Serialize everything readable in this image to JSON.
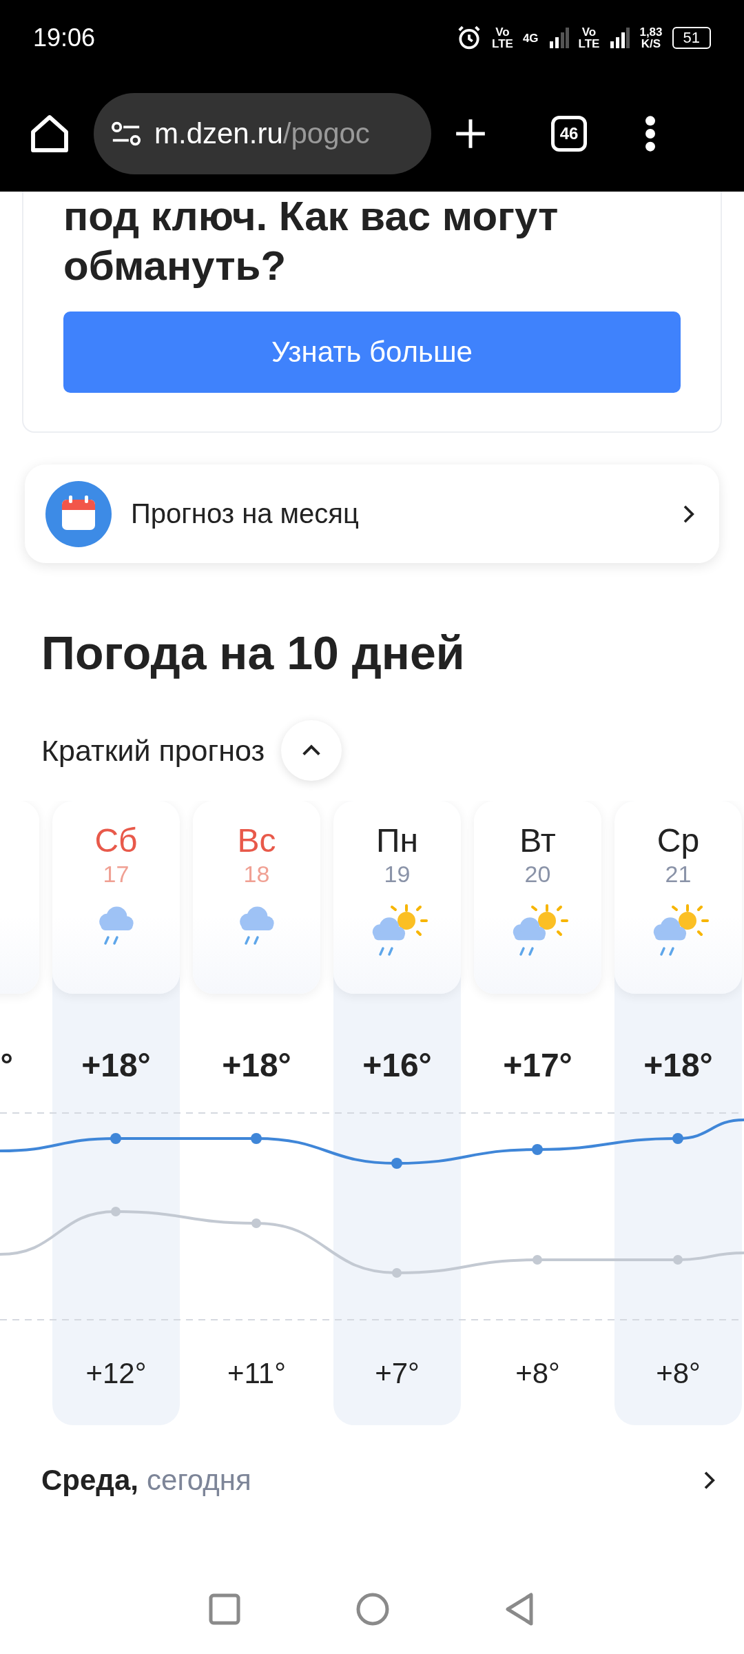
{
  "status_bar": {
    "time": "19:06",
    "sim_1": [
      "Vo",
      "LTE"
    ],
    "data_type": "4G",
    "sim_2": [
      "Vo",
      "LTE"
    ],
    "speed": [
      "1,83",
      "K/S"
    ],
    "battery": "51"
  },
  "browser": {
    "url_host": "m.dzen.ru",
    "url_path": "/pogoc",
    "tab_count": "46"
  },
  "ad_card": {
    "title": "под ключ. Как вас могут обмануть?",
    "button": "Узнать больше"
  },
  "month_link": {
    "label": "Прогноз на месяц"
  },
  "forecast": {
    "title": "Погода на 10 дней",
    "toggle": "Краткий прогноз",
    "expanded": true,
    "days": [
      {
        "kind": "partial",
        "max": "°",
        "highlighted": false
      },
      {
        "kind": "rain",
        "day": "Сб",
        "date": "17",
        "weekend": true,
        "max": "+18°",
        "min": "+12°",
        "highlighted": true
      },
      {
        "kind": "rain",
        "day": "Вс",
        "date": "18",
        "weekend": true,
        "max": "+18°",
        "min": "+11°",
        "highlighted": false
      },
      {
        "kind": "sun_rain",
        "day": "Пн",
        "date": "19",
        "weekend": false,
        "max": "+16°",
        "min": "+7°",
        "highlighted": true
      },
      {
        "kind": "sun_rain",
        "day": "Вт",
        "date": "20",
        "weekend": false,
        "max": "+17°",
        "min": "+8°",
        "highlighted": false
      },
      {
        "kind": "sun_rain",
        "day": "Ср",
        "date": "21",
        "weekend": false,
        "max": "+18°",
        "min": "+8°",
        "highlighted": true
      }
    ]
  },
  "today_row": {
    "day": "Среда,",
    "note": "сегодня"
  }
}
